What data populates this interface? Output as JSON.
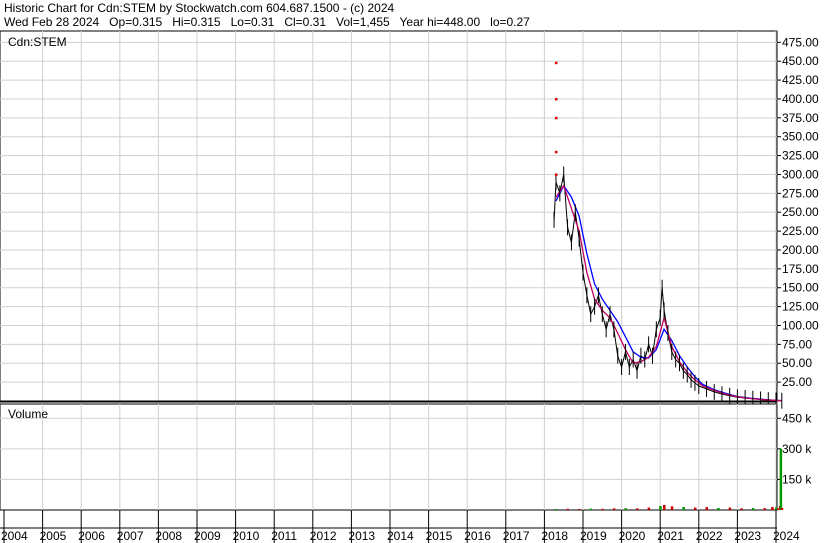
{
  "header": {
    "line1": "Historic Chart for Cdn:STEM by Stockwatch.com 604.687.1500 - (c) 2024",
    "line2": "Wed Feb 28 2024   Op=0.315   Hi=0.315   Lo=0.31   Cl=0.31   Vol=1,455   Year hi=448.00   lo=0.27"
  },
  "chart_data": [
    {
      "type": "line",
      "title": "Cdn:STEM",
      "x_years": [
        "2004",
        "2005",
        "2006",
        "2007",
        "2008",
        "2009",
        "2010",
        "2011",
        "2012",
        "2013",
        "2014",
        "2015",
        "2016",
        "2017",
        "2018",
        "2019",
        "2020",
        "2021",
        "2022",
        "2023",
        "2024"
      ],
      "ylim": [
        0,
        490
      ],
      "ytick_labels": [
        "25.00",
        "50.00",
        "75.00",
        "100.00",
        "125.00",
        "150.00",
        "175.00",
        "200.00",
        "225.00",
        "250.00",
        "275.00",
        "300.00",
        "325.00",
        "350.00",
        "375.00",
        "400.00",
        "425.00",
        "450.00",
        "475.00"
      ],
      "grid": true,
      "series": [
        {
          "color": "#000000",
          "x": [
            2018.25,
            2018.3,
            2018.4,
            2018.5,
            2018.6,
            2018.7,
            2018.8,
            2018.9,
            2019.0,
            2019.1,
            2019.2,
            2019.3,
            2019.4,
            2019.5,
            2019.6,
            2019.7,
            2019.8,
            2019.9,
            2020.0,
            2020.1,
            2020.2,
            2020.3,
            2020.4,
            2020.5,
            2020.6,
            2020.7,
            2020.8,
            2020.9,
            2021.0,
            2021.05,
            2021.1,
            2021.2,
            2021.3,
            2021.4,
            2021.5,
            2021.6,
            2021.7,
            2021.8,
            2021.9,
            2022.0,
            2022.2,
            2022.4,
            2022.6,
            2022.8,
            2023.0,
            2023.2,
            2023.4,
            2023.6,
            2023.8,
            2024.0,
            2024.15
          ],
          "y": [
            240,
            290,
            275,
            300,
            230,
            210,
            250,
            215,
            170,
            140,
            115,
            125,
            140,
            115,
            95,
            115,
            95,
            60,
            45,
            65,
            45,
            55,
            40,
            60,
            55,
            75,
            60,
            95,
            110,
            150,
            120,
            90,
            65,
            55,
            50,
            40,
            35,
            28,
            24,
            20,
            16,
            12,
            9,
            7,
            5,
            4,
            3,
            2,
            1.2,
            0.6,
            0.31
          ]
        },
        {
          "color": "#0000ff",
          "x": [
            2018.3,
            2018.5,
            2018.7,
            2018.9,
            2019.1,
            2019.3,
            2019.5,
            2019.7,
            2019.9,
            2020.1,
            2020.3,
            2020.5,
            2020.7,
            2020.9,
            2021.1,
            2021.3,
            2021.5,
            2021.7,
            2021.9,
            2022.1,
            2022.4,
            2022.7,
            2023.0,
            2023.3,
            2023.6,
            2023.9,
            2024.15
          ],
          "y": [
            265,
            285,
            270,
            245,
            195,
            155,
            135,
            120,
            105,
            85,
            65,
            58,
            57,
            68,
            95,
            80,
            60,
            45,
            32,
            22,
            15,
            10,
            6,
            4,
            2.5,
            1.2,
            0.5
          ]
        },
        {
          "color": "#c00060",
          "x": [
            2018.3,
            2018.5,
            2018.7,
            2018.9,
            2019.1,
            2019.3,
            2019.5,
            2019.7,
            2019.9,
            2020.1,
            2020.3,
            2020.5,
            2020.7,
            2020.9,
            2021.1,
            2021.3,
            2021.5,
            2021.7,
            2021.9,
            2022.1,
            2022.4,
            2022.7,
            2023.0,
            2023.3,
            2023.6,
            2023.9,
            2024.15
          ],
          "y": [
            270,
            285,
            255,
            225,
            170,
            135,
            120,
            110,
            90,
            68,
            50,
            52,
            58,
            72,
            110,
            72,
            52,
            38,
            28,
            20,
            14,
            9,
            5.5,
            3.5,
            2,
            1,
            0.4
          ]
        }
      ],
      "red_dots": {
        "x": [
          2018.3,
          2018.3,
          2018.3,
          2018.3,
          2018.3
        ],
        "y": [
          448,
          400,
          375,
          330,
          300
        ]
      }
    },
    {
      "type": "bar",
      "title": "Volume",
      "ylim": [
        0,
        520000
      ],
      "ytick_labels": [
        "150 k",
        "300 k",
        "450 k"
      ],
      "grid": true,
      "x": [
        2018.3,
        2018.6,
        2018.9,
        2019.2,
        2019.5,
        2019.8,
        2020.1,
        2020.4,
        2020.7,
        2021.0,
        2021.1,
        2021.3,
        2021.6,
        2021.9,
        2022.2,
        2022.5,
        2022.8,
        2023.1,
        2023.4,
        2023.7,
        2023.9,
        2024.0,
        2024.05,
        2024.1,
        2024.12,
        2024.15
      ],
      "values": [
        5000,
        6000,
        5000,
        7000,
        6000,
        8000,
        9000,
        8000,
        12000,
        20000,
        25000,
        18000,
        15000,
        12000,
        14000,
        10000,
        12000,
        8000,
        10000,
        9000,
        15000,
        12000,
        8000,
        20000,
        300000,
        10000
      ]
    }
  ]
}
